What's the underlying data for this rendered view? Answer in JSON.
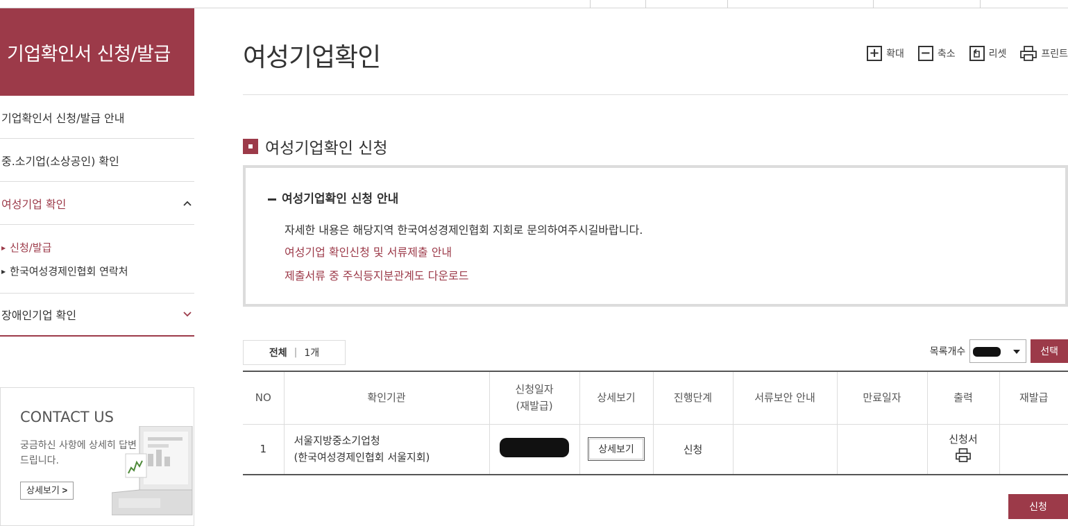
{
  "sidebar": {
    "title": "기업확인서 신청/발급",
    "items": [
      {
        "label": "기업확인서 신청/발급 안내"
      },
      {
        "label": "중.소기업(소상공인) 확인"
      },
      {
        "label": "여성기업 확인"
      },
      {
        "label": "장애인기업 확인"
      }
    ],
    "subitems": [
      {
        "label": "신청/발급"
      },
      {
        "label": "한국여성경제인협회 연락처"
      }
    ]
  },
  "contact": {
    "title": "CONTACT US",
    "desc": "궁금하신 사항에 상세히 답변 드립니다.",
    "more_label": "상세보기"
  },
  "page": {
    "title": "여성기업확인"
  },
  "toolbar": {
    "zoom_in": "확대",
    "zoom_out": "축소",
    "reset": "리셋",
    "print": "프린트"
  },
  "section": {
    "title": "여성기업확인 신청"
  },
  "info": {
    "title": "여성기업확인 신청 안내",
    "text": "자세한 내용은 해당지역 한국여성경제인협회 지회로 문의하여주시길바랍니다.",
    "link1": "여성기업 확인신청 및 서류제출 안내",
    "link2": "제출서류 중 주식등지분관계도 다운로드"
  },
  "list": {
    "total_label": "전체",
    "total_count": "1개",
    "page_size_label": "목록개수",
    "select_button": "선택"
  },
  "table": {
    "headers": {
      "no": "NO",
      "org": "확인기관",
      "date": "신청일자\n(재발급)",
      "detail": "상세보기",
      "stage": "진행단계",
      "supplement": "서류보안 안내",
      "expire": "만료일자",
      "output": "출력",
      "reissue": "재발급"
    },
    "rows": [
      {
        "no": "1",
        "org_line1": "서울지방중소기업청",
        "org_line2": "(한국여성경제인협회 서울지회)",
        "detail_button": "상세보기",
        "stage": "신청",
        "output_label": "신청서"
      }
    ]
  },
  "apply_button": "신청",
  "colors": {
    "brand": "#9c3a49"
  }
}
